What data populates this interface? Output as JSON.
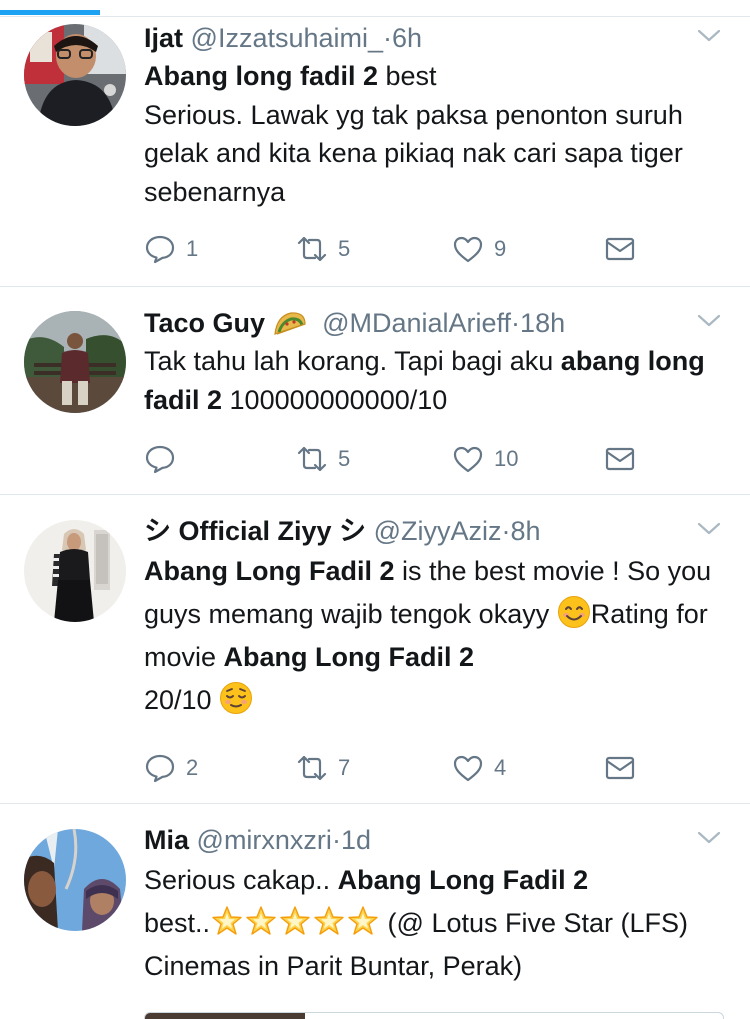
{
  "tweets": [
    {
      "name": "Ijat",
      "handle": "@Izzatsuhaimi_",
      "separator": "·",
      "time": "6h",
      "text_bold_1": "Abang long fadil 2",
      "text_plain_1": " best",
      "text_plain_2": "Serious. Lawak yg tak paksa penonton suruh gelak and kita kena pikiaq nak cari sapa tiger sebenarnya",
      "replies": "1",
      "retweets": "5",
      "likes": "9"
    },
    {
      "name": "Taco Guy",
      "name_emoji": "taco-icon",
      "handle": "@MDanialArieff",
      "separator": "·",
      "time": "18h",
      "text_plain_1": "Tak tahu lah korang. Tapi bagi aku ",
      "text_bold_1": "abang long fadil 2",
      "text_plain_2": " 100000000000/10",
      "replies": "",
      "retweets": "5",
      "likes": "10"
    },
    {
      "name": "シ Official Ziyy シ",
      "handle": "@ZiyyAziz",
      "separator": "·",
      "time": "8h",
      "text_bold_1": "Abang Long Fadil 2",
      "text_plain_1": " is the best movie ! So you guys memang wajib tengok okayy ",
      "text_plain_2": "Rating for movie ",
      "text_bold_2": "Abang Long Fadil 2",
      "text_plain_3": "20/10 ",
      "emoji_1": "smiling-face-icon",
      "emoji_2": "relieved-face-icon",
      "replies": "2",
      "retweets": "7",
      "likes": "4"
    },
    {
      "name": "Mia",
      "handle": "@mirxnxzri",
      "separator": "·",
      "time": "1d",
      "text_plain_1": "Serious cakap.. ",
      "text_bold_1": "Abang Long Fadil 2",
      "text_plain_2": "best..",
      "emoji_1": "glowing-star-icon",
      "text_plain_3": " (@ Lotus Five Star (LFS) Cinemas in Parit Buntar, Perak)"
    }
  ],
  "colors": {
    "accent": "#1da1f2",
    "text": "#14171a",
    "secondary": "#657786",
    "divider": "#e1e8ed"
  }
}
